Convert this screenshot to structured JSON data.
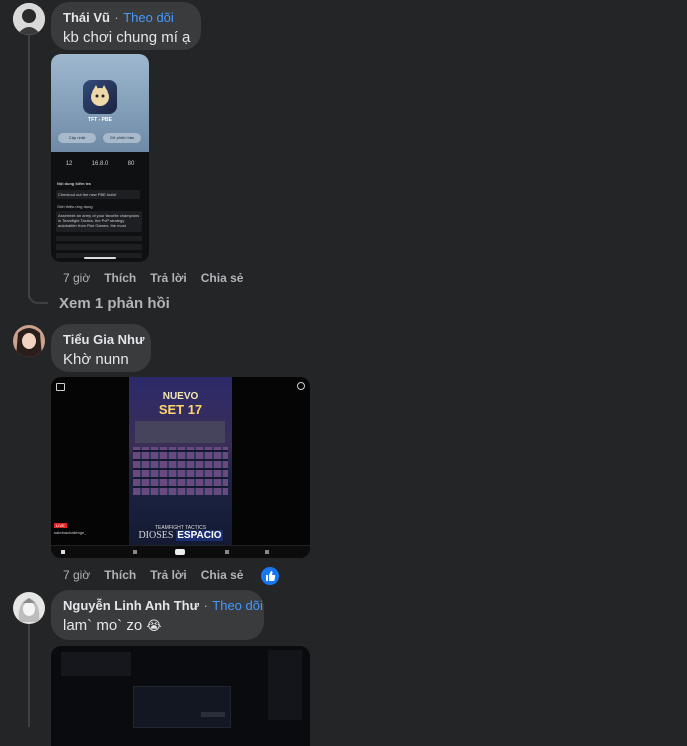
{
  "comments": [
    {
      "author": "Thái Vũ",
      "separator": "·",
      "follow_label": "Theo dõi",
      "text": "kb chơi chung mí ạ",
      "time": "7 giờ",
      "like_label": "Thích",
      "reply_label": "Trả lời",
      "share_label": "Chia sẻ",
      "view_replies": "Xem 1 phản hồi",
      "attachment": {
        "app_name": "TFT - PBE",
        "btn_left": "Cập nhật",
        "btn_right": "Gỡ phiên bản",
        "version": "16.8.0",
        "stat_1": "12",
        "stat_3": "80",
        "section_title": "Nội dung kiểm tra",
        "test_line": "Checkout out the new PBE build!",
        "desc_title": "Giới thiệu ứng dụng",
        "desc_text": "Assemble an army of your favorite champions in Teamfight Tactics, the PvP strategy autobattler from Riot Games. the most",
        "more_label": "thêm"
      }
    },
    {
      "author": "Tiểu Gia Như",
      "text": "Khờ nunn",
      "time": "7 giờ",
      "like_label": "Thích",
      "reply_label": "Trả lời",
      "share_label": "Chia sẻ",
      "attachment": {
        "banner_1": "NUEVO",
        "banner_2": "SET 17",
        "footer_1": "TEAMFIGHT TACTICS",
        "footer_2": "DIOSES",
        "footer_3": "ESPACIO",
        "channel": "sabrinachallenge_",
        "live_badge": "LIVE"
      }
    },
    {
      "author": "Nguyễn Linh Anh Thư",
      "separator": "·",
      "follow_label": "Theo dõi",
      "text": "lam` mo` zo",
      "emoji": "😭"
    }
  ],
  "colors": {
    "background": "#242526",
    "bubble": "#3a3b3c",
    "link": "#4599ff",
    "muted": "#b0b3b8",
    "like_reaction": "#1877f2"
  }
}
